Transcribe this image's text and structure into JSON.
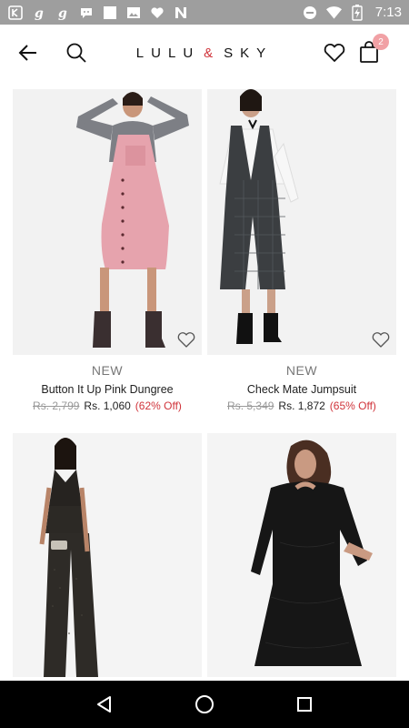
{
  "status_bar": {
    "time": "7:13",
    "icons": [
      "k-app-icon",
      "g-app-icon",
      "g-app-icon",
      "chat-bubble-icon",
      "square-app-icon",
      "image-icon",
      "heart-icon",
      "n-app-icon",
      "do-not-disturb-icon",
      "wifi-icon",
      "battery-charging-icon"
    ]
  },
  "header": {
    "brand_left": "LULU",
    "brand_amp": "&",
    "brand_right": "SKY",
    "bag_count": "2"
  },
  "products": [
    {
      "tag": "NEW",
      "name": "Button It Up Pink Dungree",
      "mrp": "Rs. 2,799",
      "price": "Rs. 1,060",
      "discount": "(62% Off)"
    },
    {
      "tag": "NEW",
      "name": "Check Mate Jumpsuit",
      "mrp": "Rs. 5,349",
      "price": "Rs. 1,872",
      "discount": "(65% Off)"
    },
    {
      "tag": "",
      "name": "",
      "mrp": "",
      "price": "",
      "discount": ""
    },
    {
      "tag": "",
      "name": "",
      "mrp": "",
      "price": "",
      "discount": ""
    }
  ],
  "colors": {
    "status_bar": "#9e9e9e",
    "accent": "#d0343b",
    "badge": "#f1a1a5",
    "nav_bar": "#000000"
  }
}
